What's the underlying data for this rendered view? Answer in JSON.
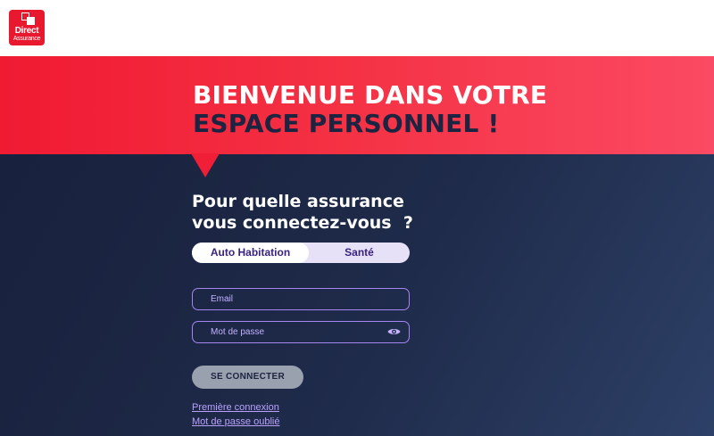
{
  "logo": {
    "line1": "Direct",
    "line2": "Assurance"
  },
  "hero": {
    "title_line1": "BIENVENUE DANS VOTRE",
    "title_line2": "ESPACE PERSONNEL !"
  },
  "login": {
    "question_line1": "Pour quelle assurance",
    "question_line2": "vous connectez-vous  ?",
    "tabs": [
      {
        "label": "Auto Habitation",
        "active": true
      },
      {
        "label": "Santé",
        "active": false
      }
    ],
    "email_placeholder": "Email",
    "password_placeholder": "Mot de passe",
    "submit_label": "SE CONNECTER",
    "first_login_link": "Première connexion",
    "forgot_password_link": "Mot de passe oublié"
  },
  "colors": {
    "brand_red": "#f01a33",
    "navy": "#1b2440",
    "accent_purple": "#a585f2"
  },
  "icons": {
    "password_toggle": "eye-icon"
  }
}
